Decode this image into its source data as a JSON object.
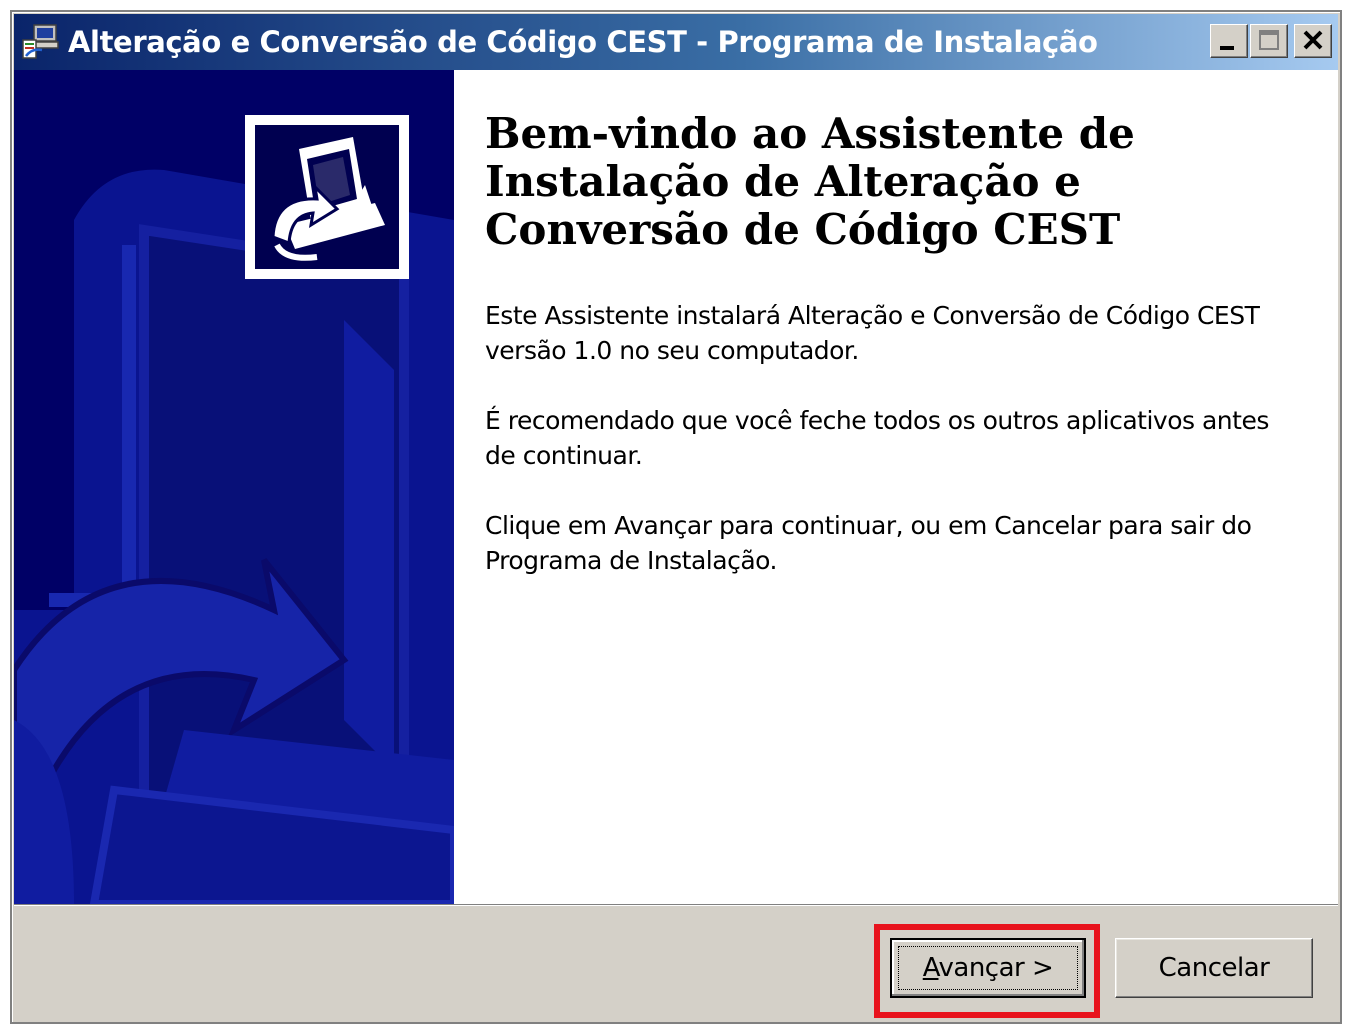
{
  "window": {
    "title": "Alteração e Conversão de Código CEST - Programa de Instalação",
    "icon": "installer-icon",
    "controls": [
      "minimize-icon",
      "maximize-icon",
      "close-icon"
    ]
  },
  "side_panel": {
    "icon": "computer-install-icon",
    "background_color": "#000066"
  },
  "content": {
    "heading": "Bem-vindo ao Assistente de\nInstalação de Alteração e\nConversão de Código CEST",
    "paragraph1": "Este Assistente instalará Alteração e Conversão de Código CEST versão 1.0 no seu computador.",
    "paragraph2": "É recomendado que você feche todos os outros aplicativos antes de continuar.",
    "paragraph3": "Clique em Avançar para continuar, ou em Cancelar para sair do Programa de Instalação."
  },
  "buttons": {
    "next_label": "Avançar >",
    "cancel_label": "Cancelar"
  },
  "colors": {
    "highlight": "#e8131d",
    "title_bar_start": "#0a246a",
    "title_bar_end": "#a6caf0"
  }
}
